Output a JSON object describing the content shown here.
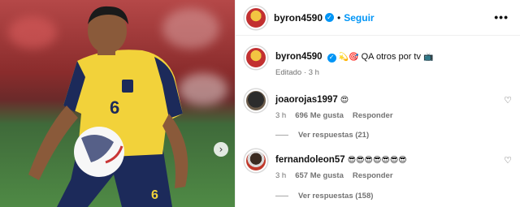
{
  "post": {
    "username": "byron4590",
    "follow_label": "Seguir",
    "more_label": "•••",
    "caption_emojis": "💫🎯",
    "caption_text": "QA otros por tv",
    "caption_tail_emoji": "📺",
    "edited_label": "Editado",
    "edited_time": "3 h",
    "next_arrow": "›"
  },
  "comments": [
    {
      "username": "joaorojas1997",
      "text": "😍",
      "time": "3 h",
      "likes": "696 Me gusta",
      "reply_label": "Responder",
      "view_replies": "Ver respuestas (21)"
    },
    {
      "username": "fernandoleon57",
      "text": "😎😎😎😎😎😎😎",
      "time": "3 h",
      "likes": "657 Me gusta",
      "reply_label": "Responder",
      "view_replies": "Ver respuestas (158)"
    }
  ],
  "icons": {
    "verified": "verified-badge-icon",
    "heart": "heart-icon",
    "next": "chevron-right-icon"
  },
  "colors": {
    "accent": "#0095f6",
    "jersey_yellow": "#f2d23a",
    "jersey_navy": "#1c2a5a"
  }
}
